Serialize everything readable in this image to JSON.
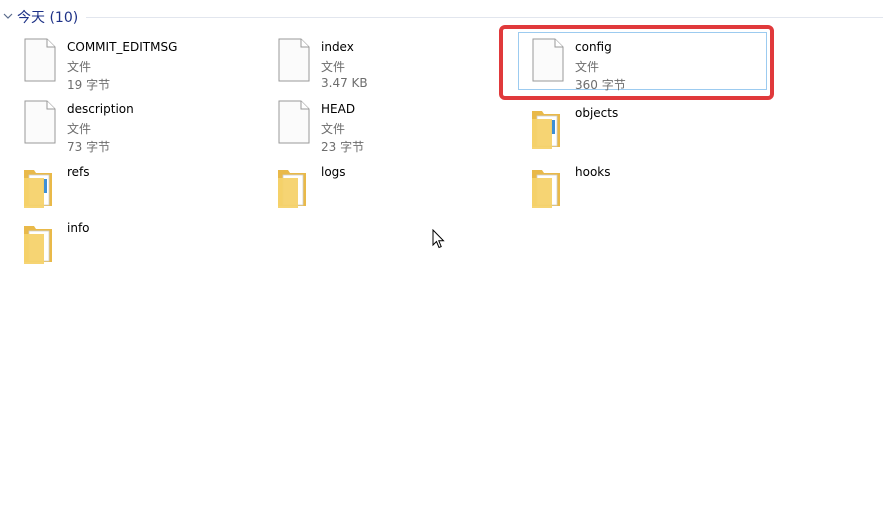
{
  "group": {
    "title": "今天 (10)"
  },
  "items": [
    {
      "name": "COMMIT_EDITMSG",
      "type": "文件",
      "size": "19 字节",
      "kind": "file-icon"
    },
    {
      "name": "index",
      "type": "文件",
      "size": "3.47 KB",
      "kind": "file-icon"
    },
    {
      "name": "config",
      "type": "文件",
      "size": "360 字节",
      "kind": "file-icon",
      "selected": true
    },
    {
      "name": "description",
      "type": "文件",
      "size": "73 字节",
      "kind": "file-icon"
    },
    {
      "name": "HEAD",
      "type": "文件",
      "size": "23 字节",
      "kind": "file-icon"
    },
    {
      "name": "objects",
      "kind": "folder-icon"
    },
    {
      "name": "refs",
      "kind": "folder-icon"
    },
    {
      "name": "logs",
      "kind": "folder-icon"
    },
    {
      "name": "hooks",
      "kind": "folder-icon"
    },
    {
      "name": "info",
      "kind": "folder-icon"
    }
  ],
  "colors": {
    "group_title": "#1e3287",
    "selection_border": "#9ccbf0",
    "highlight_frame": "#e0393b",
    "folder": "#f6d26b"
  }
}
